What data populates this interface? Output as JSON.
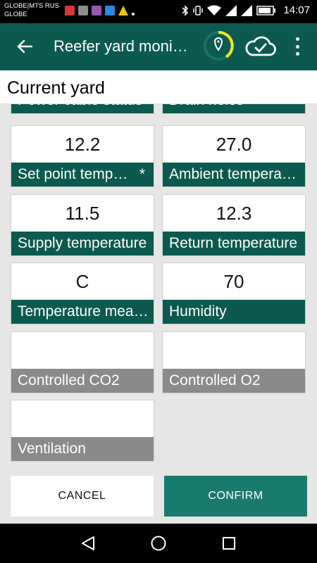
{
  "status_bar": {
    "carrier_line1": "GLOBE|MTS RUS",
    "carrier_line2": "GLOBE",
    "time": "14:07"
  },
  "app_bar": {
    "title": "Reefer yard moni…"
  },
  "section": {
    "title": "Current yard"
  },
  "tiles": [
    {
      "value": "",
      "label": "Power cable status",
      "active": true
    },
    {
      "value": "",
      "label": "Drain holes",
      "active": true
    },
    {
      "value": "12.2",
      "label": "Set point temp…",
      "active": true,
      "mark": "*"
    },
    {
      "value": "27.0",
      "label": "Ambient tempera…",
      "active": true
    },
    {
      "value": "11.5",
      "label": "Supply temperature",
      "active": true
    },
    {
      "value": "12.3",
      "label": "Return temperature",
      "active": true
    },
    {
      "value": "C",
      "label": "Temperature mea…",
      "active": true
    },
    {
      "value": "70",
      "label": "Humidity",
      "active": true
    },
    {
      "value": "",
      "label": "Controlled CO2",
      "active": false
    },
    {
      "value": "",
      "label": "Controlled O2",
      "active": false
    },
    {
      "value": "",
      "label": "Ventilation",
      "active": false
    }
  ],
  "buttons": {
    "cancel": "CANCEL",
    "confirm": "CONFIRM"
  },
  "colors": {
    "primary": "#0c5a4f",
    "accent_ring": "#f5e51b",
    "confirm": "#197b6d",
    "disabled_label": "#8a8a8a"
  },
  "icons": {
    "back": "arrow-left-icon",
    "gps": "location-pin-icon",
    "cloud": "cloud-check-icon",
    "menu": "more-vert-icon"
  }
}
